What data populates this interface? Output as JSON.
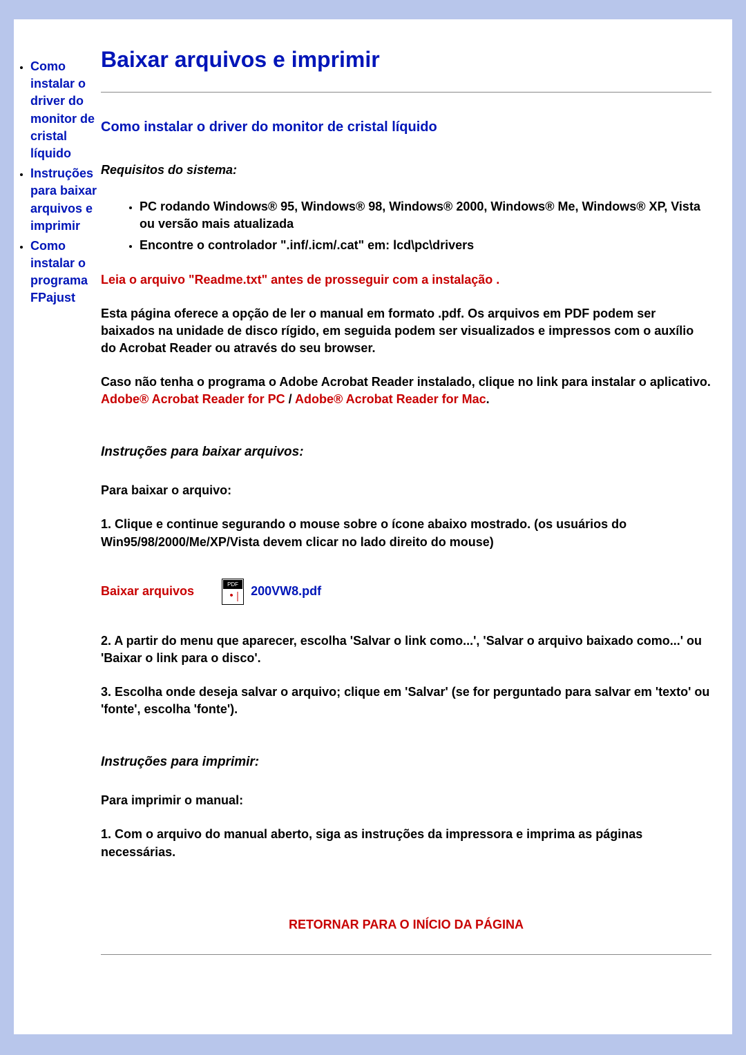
{
  "sidebar": {
    "items": [
      {
        "label": "Como instalar o driver do monitor de cristal líquido"
      },
      {
        "label": "Instruções para baixar arquivos e imprimir"
      },
      {
        "label": "Como instalar o programa FPajust"
      }
    ]
  },
  "header": {
    "title": "Baixar arquivos e imprimir"
  },
  "section1": {
    "heading": "Como instalar o driver do monitor de cristal líquido",
    "requisitos_label": "Requisitos do sistema:",
    "bullets": [
      "PC rodando Windows® 95, Windows® 98, Windows® 2000, Windows® Me, Windows® XP, Vista ou versão mais atualizada",
      "Encontre o controlador \".inf/.icm/.cat\" em: lcd\\pc\\drivers"
    ],
    "readme_warning": "Leia o arquivo \"Readme.txt\" antes de prosseguir com a instalação .",
    "pdf_intro": "Esta página oferece a opção de ler o manual em formato .pdf. Os arquivos em PDF podem ser baixados na unidade de disco rígido, em seguida podem ser visualizados e impressos com o auxílio do Acrobat Reader ou através do seu browser.",
    "acro_intro": "Caso não tenha o programa o Adobe Acrobat Reader instalado, clique no link para instalar o aplicativo. ",
    "link_pc": "Adobe® Acrobat Reader for PC",
    "sep": " / ",
    "link_mac": "Adobe® Acrobat Reader for Mac",
    "period": "."
  },
  "download": {
    "heading": "Instruções para baixar arquivos:",
    "sub_label": "Para baixar o arquivo:",
    "step1": "1. Clique e continue segurando o mouse sobre o ícone abaixo mostrado. (os usuários do Win95/98/2000/Me/XP/Vista devem clicar no lado direito do mouse)",
    "label": "Baixar arquivos",
    "pdf_name": "200VW8.pdf",
    "step2": "2. A partir do menu que aparecer, escolha 'Salvar o link como...', 'Salvar o arquivo baixado como...' ou 'Baixar o link para o disco'.",
    "step3": "3. Escolha onde deseja salvar o arquivo; clique em 'Salvar' (se for perguntado para salvar em 'texto' ou 'fonte', escolha 'fonte')."
  },
  "print": {
    "heading": "Instruções para imprimir:",
    "sub_label": "Para imprimir o manual:",
    "step1": "1. Com o arquivo do manual aberto, siga as instruções da impressora e imprima as páginas necessárias."
  },
  "footer": {
    "return_link": "RETORNAR PARA O INÍCIO DA PÁGINA"
  }
}
